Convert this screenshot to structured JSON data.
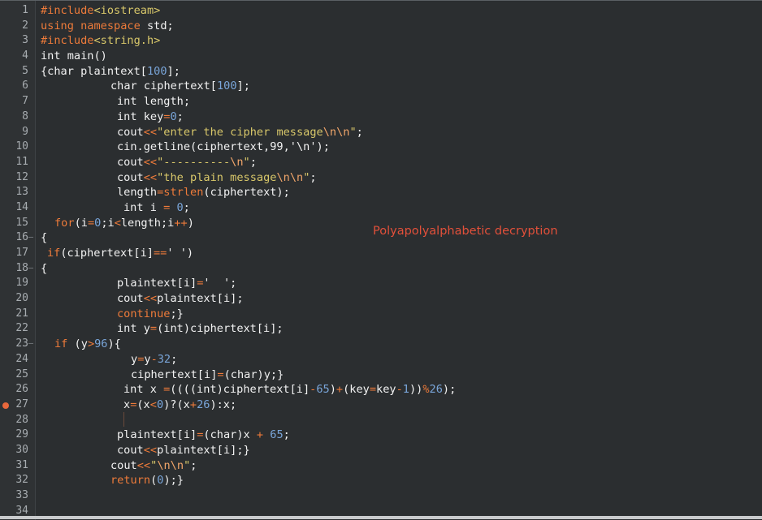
{
  "annotation": "Polyapolyalphabetic decryption",
  "breakpoint_line": 27,
  "fold_lines": [
    16,
    18,
    23
  ],
  "lines": [
    {
      "n": "1",
      "indent": 0,
      "tokens": [
        [
          "kw",
          "#include"
        ],
        [
          "str",
          "<iostream>"
        ]
      ]
    },
    {
      "n": "2",
      "indent": 0,
      "tokens": [
        [
          "kw",
          "using namespace"
        ],
        [
          "plain",
          " std;"
        ]
      ]
    },
    {
      "n": "3",
      "indent": 0,
      "tokens": [
        [
          "kw",
          "#include"
        ],
        [
          "str",
          "<string.h>"
        ]
      ]
    },
    {
      "n": "4",
      "indent": 0,
      "tokens": [
        [
          "plain",
          "int main()"
        ]
      ]
    },
    {
      "n": "5",
      "indent": 0,
      "tokens": [
        [
          "plain",
          "{char plaintext["
        ],
        [
          "num",
          "100"
        ],
        [
          "plain",
          "];"
        ]
      ]
    },
    {
      "n": "6",
      "indent": 86,
      "tokens": [
        [
          "plain",
          "char ciphertext["
        ],
        [
          "num",
          "100"
        ],
        [
          "plain",
          "];"
        ]
      ]
    },
    {
      "n": "7",
      "indent": 94,
      "tokens": [
        [
          "plain",
          "int length;"
        ]
      ]
    },
    {
      "n": "8",
      "indent": 94,
      "tokens": [
        [
          "plain",
          "int key"
        ],
        [
          "op",
          "="
        ],
        [
          "num",
          "0"
        ],
        [
          "plain",
          ";"
        ]
      ]
    },
    {
      "n": "9",
      "indent": 94,
      "tokens": [
        [
          "plain",
          "cout"
        ],
        [
          "op",
          "<<"
        ],
        [
          "str",
          "\"enter the cipher message"
        ],
        [
          "esc",
          "\\n\\n"
        ],
        [
          "str",
          "\""
        ],
        [
          "plain",
          ";"
        ]
      ]
    },
    {
      "n": "10",
      "indent": 94,
      "tokens": [
        [
          "plain",
          "cin.getline(ciphertext,99,'\\n');"
        ]
      ]
    },
    {
      "n": "11",
      "indent": 94,
      "tokens": [
        [
          "plain",
          "cout"
        ],
        [
          "op",
          "<<"
        ],
        [
          "str",
          "\"----------"
        ],
        [
          "esc",
          "\\n"
        ],
        [
          "str",
          "\""
        ],
        [
          "plain",
          ";"
        ]
      ]
    },
    {
      "n": "12",
      "indent": 94,
      "tokens": [
        [
          "plain",
          "cout"
        ],
        [
          "op",
          "<<"
        ],
        [
          "str",
          "\"the plain message"
        ],
        [
          "esc",
          "\\n\\n"
        ],
        [
          "str",
          "\""
        ],
        [
          "plain",
          ";"
        ]
      ]
    },
    {
      "n": "13",
      "indent": 94,
      "tokens": [
        [
          "plain",
          "length"
        ],
        [
          "op",
          "="
        ],
        [
          "kw",
          "strlen"
        ],
        [
          "plain",
          "(ciphertext);"
        ]
      ]
    },
    {
      "n": "14",
      "indent": 102,
      "tokens": [
        [
          "plain",
          "int i "
        ],
        [
          "op",
          "="
        ],
        [
          "plain",
          " "
        ],
        [
          "num",
          "0"
        ],
        [
          "plain",
          ";"
        ]
      ]
    },
    {
      "n": "15",
      "indent": 17,
      "tokens": [
        [
          "kw",
          "for"
        ],
        [
          "plain",
          "(i"
        ],
        [
          "op",
          "="
        ],
        [
          "num",
          "0"
        ],
        [
          "plain",
          ";i"
        ],
        [
          "op",
          "<"
        ],
        [
          "plain",
          "length;i"
        ],
        [
          "op",
          "++"
        ],
        [
          "plain",
          ")"
        ]
      ]
    },
    {
      "n": "16",
      "indent": 0,
      "tokens": [
        [
          "plain",
          "{"
        ]
      ]
    },
    {
      "n": "17",
      "indent": 8,
      "tokens": [
        [
          "kw",
          "if"
        ],
        [
          "plain",
          "(ciphertext[i]"
        ],
        [
          "op",
          "=="
        ],
        [
          "plain",
          "' ')"
        ]
      ]
    },
    {
      "n": "18",
      "indent": 0,
      "tokens": [
        [
          "plain",
          "{"
        ]
      ]
    },
    {
      "n": "19",
      "indent": 94,
      "tokens": [
        [
          "plain",
          "plaintext[i]"
        ],
        [
          "op",
          "="
        ],
        [
          "plain",
          "'  ';"
        ]
      ]
    },
    {
      "n": "20",
      "indent": 94,
      "tokens": [
        [
          "plain",
          "cout"
        ],
        [
          "op",
          "<<"
        ],
        [
          "plain",
          "plaintext[i];"
        ]
      ]
    },
    {
      "n": "21",
      "indent": 94,
      "tokens": [
        [
          "kw",
          "continue"
        ],
        [
          "plain",
          ";}"
        ]
      ]
    },
    {
      "n": "22",
      "indent": 94,
      "tokens": [
        [
          "plain",
          "int y"
        ],
        [
          "op",
          "="
        ],
        [
          "plain",
          "(int)ciphertext[i];"
        ]
      ]
    },
    {
      "n": "23",
      "indent": 17,
      "tokens": [
        [
          "kw",
          "if"
        ],
        [
          "plain",
          " (y"
        ],
        [
          "op",
          ">"
        ],
        [
          "num",
          "96"
        ],
        [
          "plain",
          "){"
        ]
      ]
    },
    {
      "n": "24",
      "indent": 111,
      "tokens": [
        [
          "plain",
          "y"
        ],
        [
          "op",
          "="
        ],
        [
          "plain",
          "y"
        ],
        [
          "op",
          "-"
        ],
        [
          "num",
          "32"
        ],
        [
          "plain",
          ";"
        ]
      ]
    },
    {
      "n": "25",
      "indent": 111,
      "tokens": [
        [
          "plain",
          "ciphertext[i]"
        ],
        [
          "op",
          "="
        ],
        [
          "plain",
          "(char)y;}"
        ]
      ]
    },
    {
      "n": "26",
      "indent": 102,
      "tokens": [
        [
          "plain",
          "int x "
        ],
        [
          "op",
          "="
        ],
        [
          "plain",
          "((((int)ciphertext[i]"
        ],
        [
          "op",
          "-"
        ],
        [
          "num",
          "65"
        ],
        [
          "plain",
          ")"
        ],
        [
          "op",
          "+"
        ],
        [
          "plain",
          "(key"
        ],
        [
          "op",
          "="
        ],
        [
          "plain",
          "key"
        ],
        [
          "op",
          "-"
        ],
        [
          "num",
          "1"
        ],
        [
          "plain",
          "))"
        ],
        [
          "op",
          "%"
        ],
        [
          "num",
          "26"
        ],
        [
          "plain",
          ");"
        ]
      ]
    },
    {
      "n": "27",
      "indent": 102,
      "tokens": [
        [
          "plain",
          "x"
        ],
        [
          "op",
          "="
        ],
        [
          "plain",
          "(x"
        ],
        [
          "op",
          "<"
        ],
        [
          "num",
          "0"
        ],
        [
          "plain",
          ")?(x"
        ],
        [
          "op",
          "+"
        ],
        [
          "num",
          "26"
        ],
        [
          "plain",
          "):x;"
        ]
      ]
    },
    {
      "n": "28",
      "indent": 0,
      "tokens": []
    },
    {
      "n": "29",
      "indent": 94,
      "tokens": [
        [
          "plain",
          "plaintext[i]"
        ],
        [
          "op",
          "="
        ],
        [
          "plain",
          "(char)x "
        ],
        [
          "op",
          "+"
        ],
        [
          "plain",
          " "
        ],
        [
          "num",
          "65"
        ],
        [
          "plain",
          ";"
        ]
      ]
    },
    {
      "n": "30",
      "indent": 94,
      "tokens": [
        [
          "plain",
          "cout"
        ],
        [
          "op",
          "<<"
        ],
        [
          "plain",
          "plaintext[i];}"
        ]
      ]
    },
    {
      "n": "31",
      "indent": 86,
      "tokens": [
        [
          "plain",
          "cout"
        ],
        [
          "op",
          "<<"
        ],
        [
          "str",
          "\""
        ],
        [
          "esc",
          "\\n\\n"
        ],
        [
          "str",
          "\""
        ],
        [
          "plain",
          ";"
        ]
      ]
    },
    {
      "n": "32",
      "indent": 86,
      "tokens": [
        [
          "kw",
          "return"
        ],
        [
          "plain",
          "("
        ],
        [
          "num",
          "0"
        ],
        [
          "plain",
          ");}"
        ]
      ]
    },
    {
      "n": "33",
      "indent": 0,
      "tokens": []
    },
    {
      "n": "34",
      "indent": 0,
      "tokens": []
    }
  ]
}
